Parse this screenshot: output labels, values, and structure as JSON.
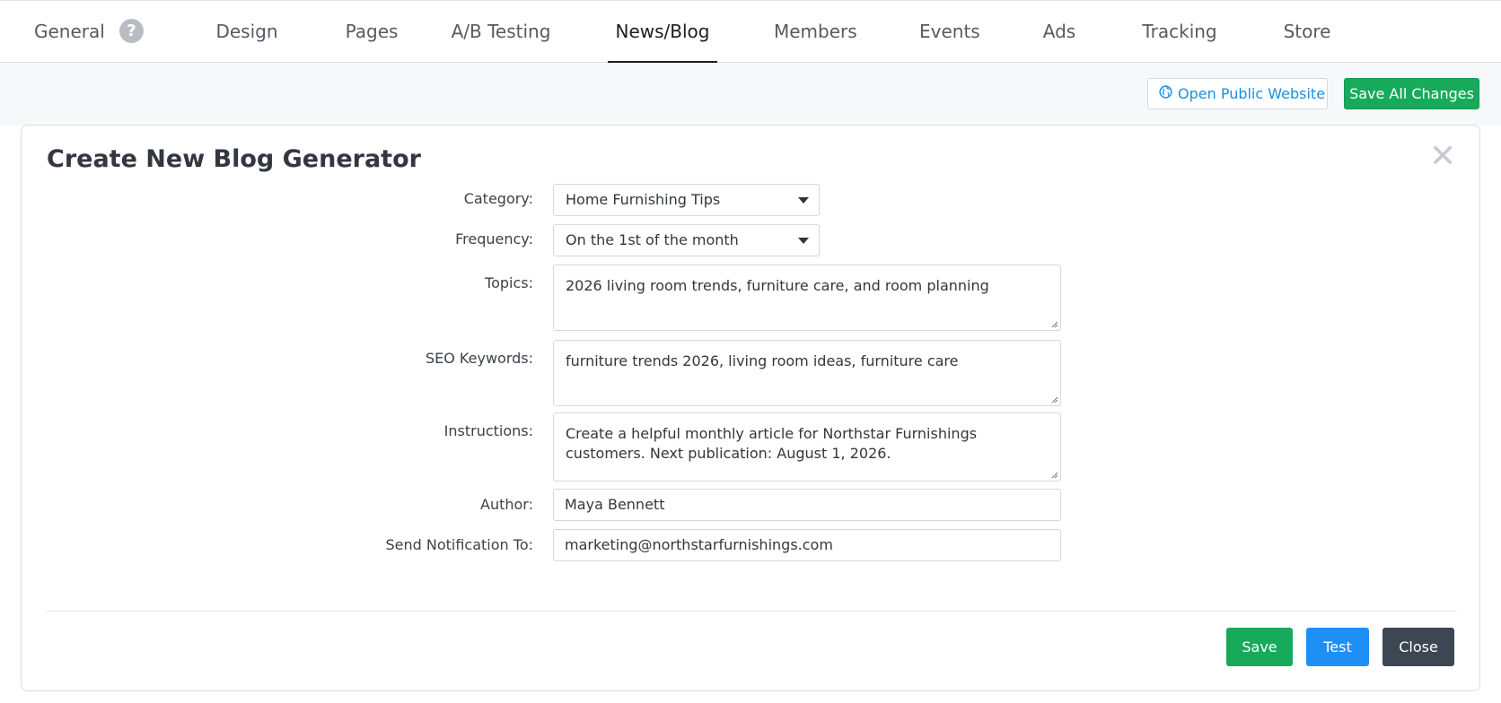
{
  "nav": {
    "tabs": [
      {
        "label": "General"
      },
      {
        "label": "Design"
      },
      {
        "label": "Pages"
      },
      {
        "label": "A/B Testing"
      },
      {
        "label": "News/Blog"
      },
      {
        "label": "Members"
      },
      {
        "label": "Events"
      },
      {
        "label": "Ads"
      },
      {
        "label": "Tracking"
      },
      {
        "label": "Store"
      }
    ],
    "active_tab": "News/Blog",
    "help_badge": "?"
  },
  "toolbar": {
    "open_public_label": "Open Public Website",
    "save_all_label": "Save All Changes"
  },
  "modal": {
    "title": "Create New Blog Generator",
    "close_glyph": "✕",
    "fields": {
      "category": {
        "label": "Category:",
        "value": "Home Furnishing Tips"
      },
      "frequency": {
        "label": "Frequency:",
        "value": "On the 1st of the month"
      },
      "topics": {
        "label": "Topics:",
        "value": "2026 living room trends, furniture care, and room planning"
      },
      "seo_keywords": {
        "label": "SEO Keywords:",
        "value": "furniture trends 2026, living room ideas, furniture care"
      },
      "instructions": {
        "label": "Instructions:",
        "value_line1": "Create a helpful monthly article for Northstar Furnishings",
        "value_line2": "customers. Next publication: August 1, 2026."
      },
      "author": {
        "label": "Author:",
        "value": "Maya Bennett"
      },
      "notify": {
        "label": "Send Notification To:",
        "value": "marketing@northstarfurnishings.com"
      }
    },
    "buttons": {
      "save": "Save",
      "test": "Test",
      "close": "Close"
    }
  },
  "colors": {
    "green": "#17aa5a",
    "blue": "#1e90f5",
    "dark": "#3d4754",
    "link": "#1a8fe0"
  },
  "icons": {
    "open_public": "globe-icon",
    "help": "question-circle-icon",
    "close": "close-icon",
    "select_caret": "caret-down-icon"
  }
}
